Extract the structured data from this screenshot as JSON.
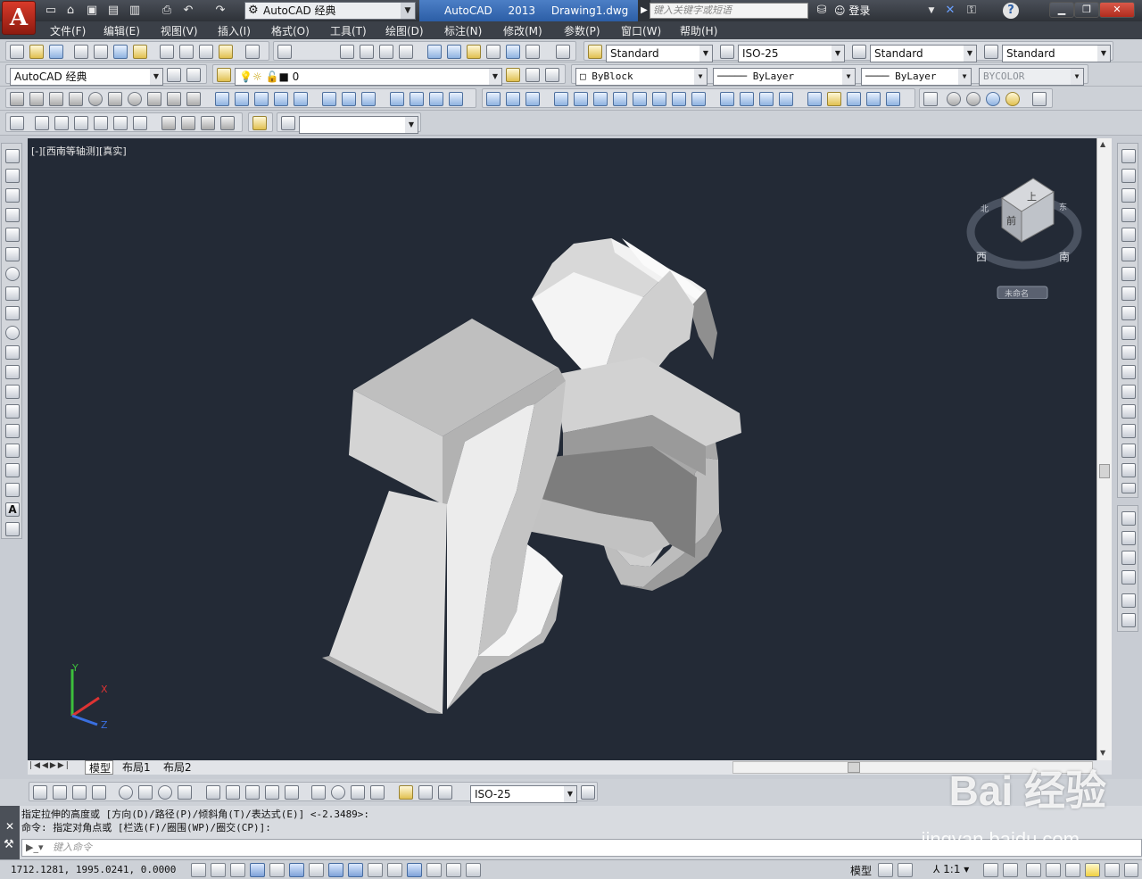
{
  "app": {
    "title": "AutoCAD 2013",
    "document": "Drawing1.dwg",
    "workspace": "AutoCAD 经典",
    "search_placeholder": "键入关键字或短语",
    "login": "登录"
  },
  "menu": [
    "文件(F)",
    "编辑(E)",
    "视图(V)",
    "插入(I)",
    "格式(O)",
    "工具(T)",
    "绘图(D)",
    "标注(N)",
    "修改(M)",
    "参数(P)",
    "窗口(W)",
    "帮助(H)"
  ],
  "toolbar": {
    "text_style": "Standard",
    "dim_style": "ISO-25",
    "table_style": "Standard",
    "mleader_style": "Standard",
    "workspace_combo": "AutoCAD 经典",
    "layer_name": "0",
    "color": "ByBlock",
    "linetype": "ByLayer",
    "lineweight": "ByLayer",
    "plot_style": "BYCOLOR"
  },
  "viewport": {
    "label": "[-][西南等轴测][真实]",
    "viewcube_top": "上",
    "viewcube_front": "前",
    "viewcube_compass_west": "西",
    "viewcube_compass_south": "南",
    "viewcube_compass_north": "北",
    "viewcube_compass_east": "东",
    "wcs_label": "未命名",
    "ucs_x": "X",
    "ucs_y": "Y",
    "ucs_z": "Z"
  },
  "layout_tabs": [
    "模型",
    "布局1",
    "布局2"
  ],
  "dim_toolbar_combo": "ISO-25",
  "command": {
    "history": [
      "指定拉伸的高度或 [方向(D)/路径(P)/倾斜角(T)/表达式(E)] <-2.3489>:",
      "命令: 指定对角点或 [栏选(F)/圈围(WP)/圈交(CP)]:"
    ],
    "input_placeholder": "键入命令"
  },
  "status": {
    "coords": "1712.1281, 1995.0241, 0.0000",
    "model": "模型",
    "scale": "1:1"
  },
  "watermark": {
    "text": "Bai 经验",
    "url": "jingyan.baidu.com"
  }
}
